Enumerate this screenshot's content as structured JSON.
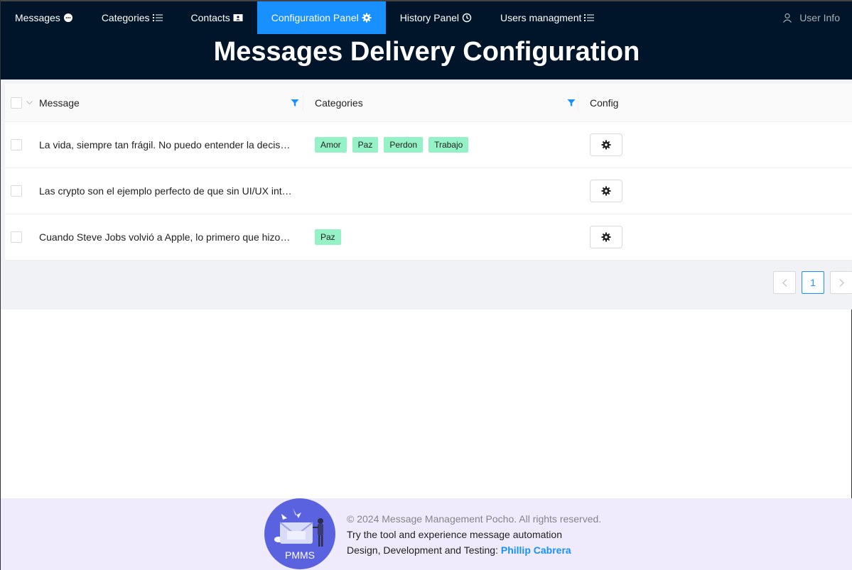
{
  "nav": {
    "items": [
      {
        "label": "Messages",
        "icon": "message-bubble-icon"
      },
      {
        "label": "Categories",
        "icon": "list-icon"
      },
      {
        "label": "Contacts",
        "icon": "contact-card-icon"
      },
      {
        "label": "Configuration Panel",
        "icon": "gear-icon",
        "active": true
      },
      {
        "label": "History Panel",
        "icon": "history-clock-icon"
      },
      {
        "label": "Users managment",
        "icon": "list-icon"
      }
    ],
    "user_info": "User Info"
  },
  "page_title": "Messages Delivery Configuration",
  "table": {
    "columns": {
      "message": "Message",
      "categories": "Categories",
      "config": "Config"
    },
    "rows": [
      {
        "message": "La vida, siempre tan frágil. No puedo entender la decisión de terminar tan pronto",
        "categories": [
          "Amor",
          "Paz",
          "Perdon",
          "Trabajo"
        ]
      },
      {
        "message": "Las crypto son el ejemplo perfecto de que sin UI/UX intuitivos no hay adopción",
        "categories": []
      },
      {
        "message": "Cuando Steve Jobs volvió a Apple, lo primero que hizo fue simplificar",
        "categories": [
          "Paz"
        ]
      }
    ]
  },
  "pagination": {
    "current": "1"
  },
  "footer": {
    "copyright": "© 2024 Message Management Pocho. All rights reserved.",
    "tagline": "Try the tool and experience message automation",
    "credit_prefix": "Design, Development and Testing: ",
    "credit_name": "Phillip Cabrera",
    "logo_text": "PMMS"
  },
  "colors": {
    "header_bg": "#001529",
    "accent": "#1890ff",
    "tag_bg": "#95f2c6",
    "footer_bg": "#f0ebfc",
    "logo_bg": "#5b62e0"
  }
}
